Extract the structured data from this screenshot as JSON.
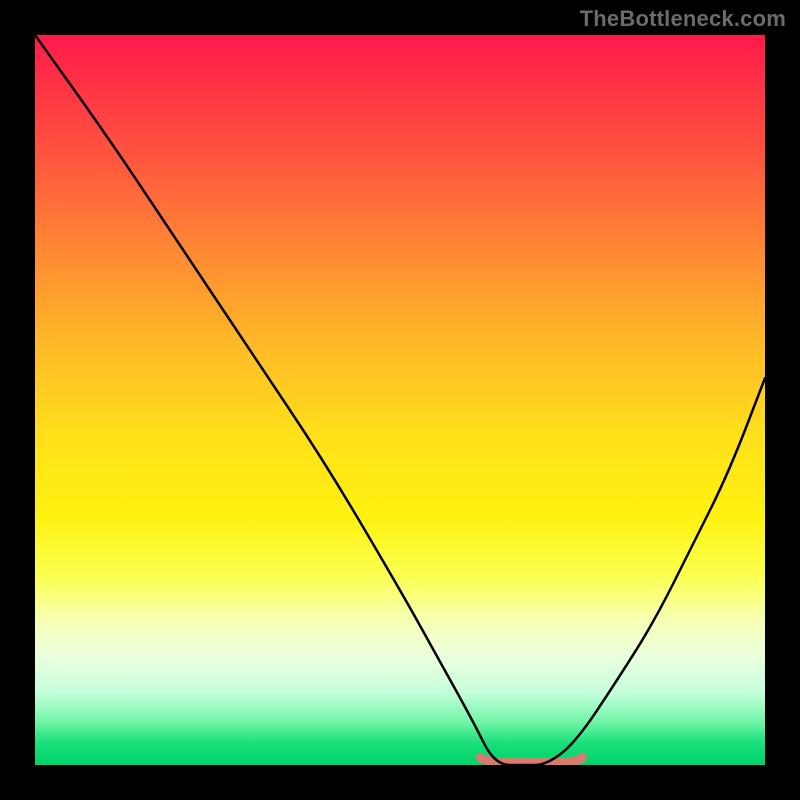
{
  "watermark": "TheBottleneck.com",
  "chart_data": {
    "type": "line",
    "title": "",
    "xlabel": "",
    "ylabel": "",
    "xlim": [
      0,
      100
    ],
    "ylim": [
      0,
      100
    ],
    "grid": false,
    "legend": false,
    "series": [
      {
        "name": "bottleneck-curve",
        "x": [
          0,
          10,
          20,
          30,
          40,
          50,
          55,
          60,
          63,
          67,
          70,
          74,
          80,
          85,
          90,
          95,
          100
        ],
        "values": [
          100,
          86,
          71,
          56,
          41,
          24,
          15,
          6,
          0,
          0,
          0,
          3,
          12,
          20,
          30,
          40,
          53
        ]
      }
    ],
    "highlight_segment": {
      "name": "optimal-range",
      "x_start": 61,
      "x_end": 75,
      "y": 0,
      "color": "#d97a6f",
      "thickness": 9
    },
    "background_gradient": {
      "direction": "vertical",
      "stops": [
        {
          "pos": 0.0,
          "color": "#ff1a4b"
        },
        {
          "pos": 0.18,
          "color": "#ff5a3e"
        },
        {
          "pos": 0.42,
          "color": "#ffb828"
        },
        {
          "pos": 0.66,
          "color": "#fff210"
        },
        {
          "pos": 0.85,
          "color": "#ecffde"
        },
        {
          "pos": 1.0,
          "color": "#00d26a"
        }
      ]
    }
  }
}
